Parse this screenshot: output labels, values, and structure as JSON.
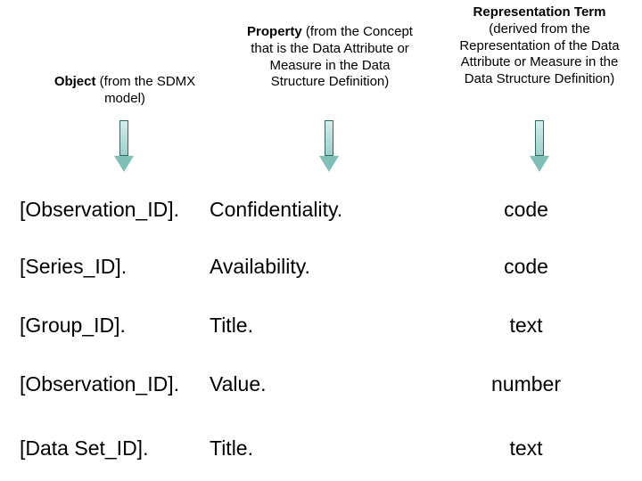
{
  "headers": {
    "object": {
      "term": "Object",
      "paren": " (from the SDMX model)"
    },
    "property": {
      "term": "Property",
      "paren": " (from the Concept that is the Data Attribute or Measure in the Data Structure Definition)"
    },
    "representation": {
      "term": "Representation Term",
      "paren": "(derived from the Representation of the Data Attribute or Measure in the Data Structure Definition)"
    }
  },
  "rows": [
    {
      "object": "[Observation_ID].",
      "property": "Confidentiality.",
      "rep": "code"
    },
    {
      "object": "[Series_ID].",
      "property": "Availability.",
      "rep": "code"
    },
    {
      "object": "[Group_ID].",
      "property": "Title.",
      "rep": "text"
    },
    {
      "object": "[Observation_ID].",
      "property": "Value.",
      "rep": "number"
    },
    {
      "object": "[Data Set_ID].",
      "property": "Title.",
      "rep": "text"
    }
  ]
}
